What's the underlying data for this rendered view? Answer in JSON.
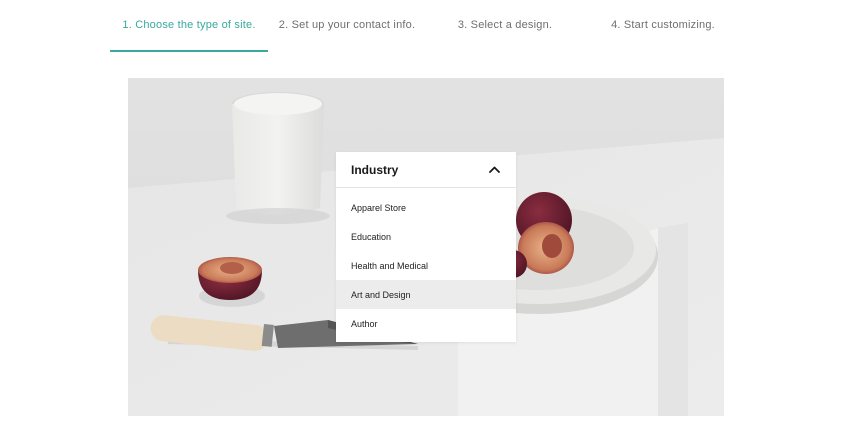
{
  "steps": [
    {
      "label": "1. Choose the type of site.",
      "active": true
    },
    {
      "label": "2. Set up your contact info.",
      "active": false
    },
    {
      "label": "3. Select a design.",
      "active": false
    },
    {
      "label": "4. Start customizing.",
      "active": false
    }
  ],
  "colors": {
    "accent": "#38a99c",
    "inactive_text": "#6f6f6f",
    "hover_row": "#ececec"
  },
  "dropdown": {
    "title": "Industry",
    "toggle_icon": "chevron-up-icon",
    "items": [
      {
        "label": "Apparel Store"
      },
      {
        "label": "Education"
      },
      {
        "label": "Health and Medical"
      },
      {
        "label": "Art and Design",
        "highlighted": true
      },
      {
        "label": "Author"
      }
    ]
  }
}
